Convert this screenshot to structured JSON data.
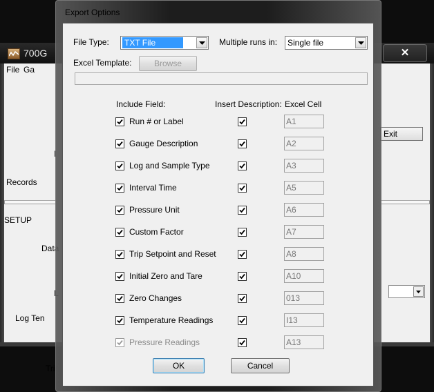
{
  "background_app": {
    "title": "700G",
    "menu": [
      "File",
      "Ga"
    ],
    "labels": {
      "records": "Records",
      "setup": "SETUP",
      "data": "Data",
      "log_ten": "Log Ten",
      "trip": "Trip",
      "l1": "I",
      "l2": "L"
    },
    "exit_label": "Exit",
    "close_glyph": "✕"
  },
  "dialog": {
    "title": "Export Options",
    "file_type_label": "File Type:",
    "file_type_value": "TXT File",
    "multiple_runs_label": "Multiple runs in:",
    "multiple_runs_value": "Single file",
    "excel_template_label": "Excel Template:",
    "browse_label": "Browse",
    "template_path": "",
    "headers": {
      "include_field": "Include Field:",
      "insert_description": "Insert Description:",
      "excel_cell": "Excel Cell"
    },
    "fields": [
      {
        "label": "Run # or Label",
        "include": true,
        "describe": true,
        "cell": "A1",
        "enabled": true
      },
      {
        "label": "Gauge Description",
        "include": true,
        "describe": true,
        "cell": "A2",
        "enabled": true
      },
      {
        "label": "Log and Sample Type",
        "include": true,
        "describe": true,
        "cell": "A3",
        "enabled": true
      },
      {
        "label": "Interval Time",
        "include": true,
        "describe": true,
        "cell": "A5",
        "enabled": true
      },
      {
        "label": "Pressure Unit",
        "include": true,
        "describe": true,
        "cell": "A6",
        "enabled": true
      },
      {
        "label": "Custom Factor",
        "include": true,
        "describe": true,
        "cell": "A7",
        "enabled": true
      },
      {
        "label": "Trip Setpoint and Reset",
        "include": true,
        "describe": true,
        "cell": "A8",
        "enabled": true
      },
      {
        "label": "Initial Zero and Tare",
        "include": true,
        "describe": true,
        "cell": "A10",
        "enabled": true
      },
      {
        "label": "Zero Changes",
        "include": true,
        "describe": true,
        "cell": "013",
        "enabled": true
      },
      {
        "label": "Temperature Readings",
        "include": true,
        "describe": true,
        "cell": "I13",
        "enabled": true
      },
      {
        "label": "Pressure Readings",
        "include": true,
        "describe": true,
        "cell": "A13",
        "enabled": false
      }
    ],
    "ok_label": "OK",
    "cancel_label": "Cancel"
  },
  "colors": {
    "selection": "#3399ff",
    "dialog_face": "#f0f0f0",
    "disabled_text": "#8c8c8c"
  }
}
